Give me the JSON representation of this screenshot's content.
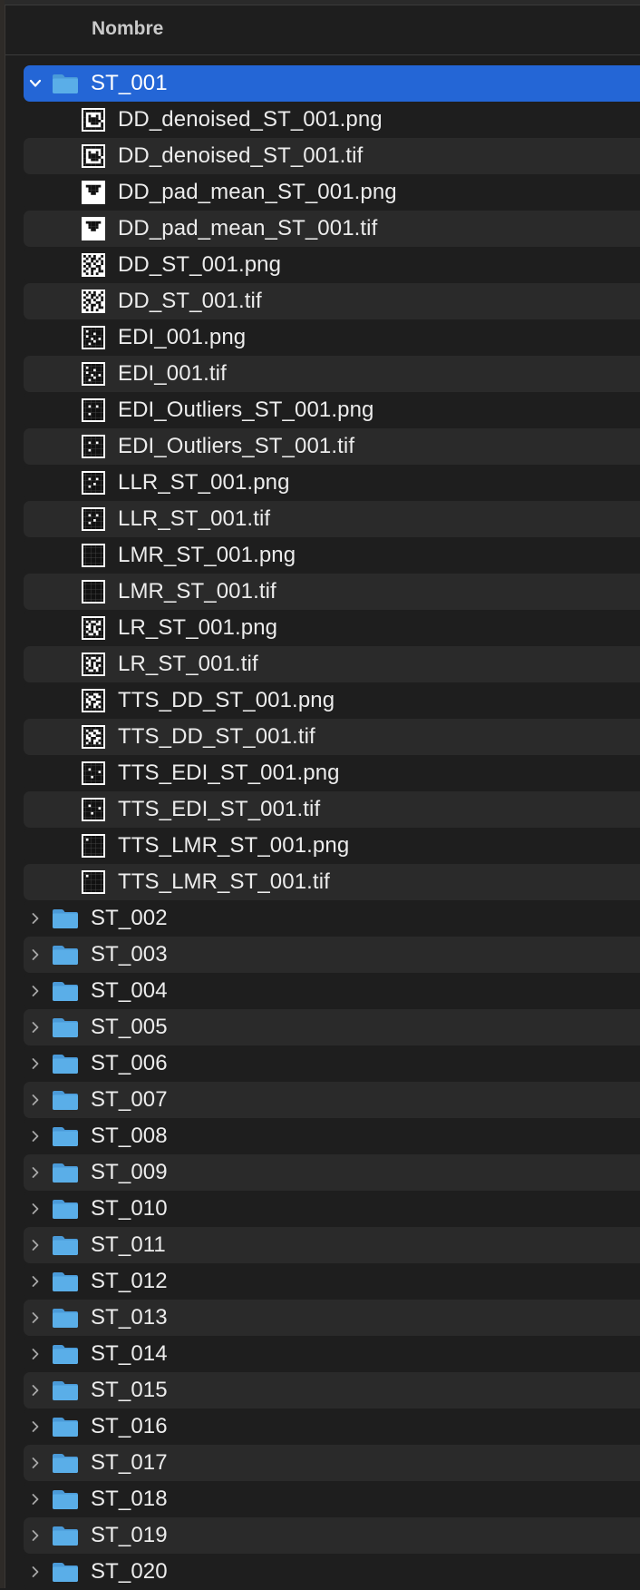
{
  "header": {
    "column_label": "Nombre"
  },
  "colors": {
    "selection": "#2466d6",
    "folder": "#5aaee8",
    "row_alt": "#2a2a2a",
    "background": "#1e1e1e"
  },
  "expanded_folder": {
    "name": "ST_001",
    "icon": "folder-icon",
    "files": [
      {
        "name": "DD_denoised_ST_001.png",
        "thumb": "dd-denoised"
      },
      {
        "name": "DD_denoised_ST_001.tif",
        "thumb": "dd-denoised"
      },
      {
        "name": "DD_pad_mean_ST_001.png",
        "thumb": "dd-pad-mean"
      },
      {
        "name": "DD_pad_mean_ST_001.tif",
        "thumb": "dd-pad-mean"
      },
      {
        "name": "DD_ST_001.png",
        "thumb": "dd"
      },
      {
        "name": "DD_ST_001.tif",
        "thumb": "dd"
      },
      {
        "name": "EDI_001.png",
        "thumb": "edi"
      },
      {
        "name": "EDI_001.tif",
        "thumb": "edi"
      },
      {
        "name": "EDI_Outliers_ST_001.png",
        "thumb": "edi-outliers"
      },
      {
        "name": "EDI_Outliers_ST_001.tif",
        "thumb": "edi-outliers"
      },
      {
        "name": "LLR_ST_001.png",
        "thumb": "llr"
      },
      {
        "name": "LLR_ST_001.tif",
        "thumb": "llr"
      },
      {
        "name": "LMR_ST_001.png",
        "thumb": "lmr"
      },
      {
        "name": "LMR_ST_001.tif",
        "thumb": "lmr"
      },
      {
        "name": "LR_ST_001.png",
        "thumb": "lr"
      },
      {
        "name": "LR_ST_001.tif",
        "thumb": "lr"
      },
      {
        "name": "TTS_DD_ST_001.png",
        "thumb": "tts-dd"
      },
      {
        "name": "TTS_DD_ST_001.tif",
        "thumb": "tts-dd"
      },
      {
        "name": "TTS_EDI_ST_001.png",
        "thumb": "tts-edi"
      },
      {
        "name": "TTS_EDI_ST_001.tif",
        "thumb": "tts-edi"
      },
      {
        "name": "TTS_LMR_ST_001.png",
        "thumb": "tts-lmr"
      },
      {
        "name": "TTS_LMR_ST_001.tif",
        "thumb": "tts-lmr"
      }
    ]
  },
  "collapsed_folders": [
    "ST_002",
    "ST_003",
    "ST_004",
    "ST_005",
    "ST_006",
    "ST_007",
    "ST_008",
    "ST_009",
    "ST_010",
    "ST_011",
    "ST_012",
    "ST_013",
    "ST_014",
    "ST_015",
    "ST_016",
    "ST_017",
    "ST_018",
    "ST_019",
    "ST_020"
  ]
}
